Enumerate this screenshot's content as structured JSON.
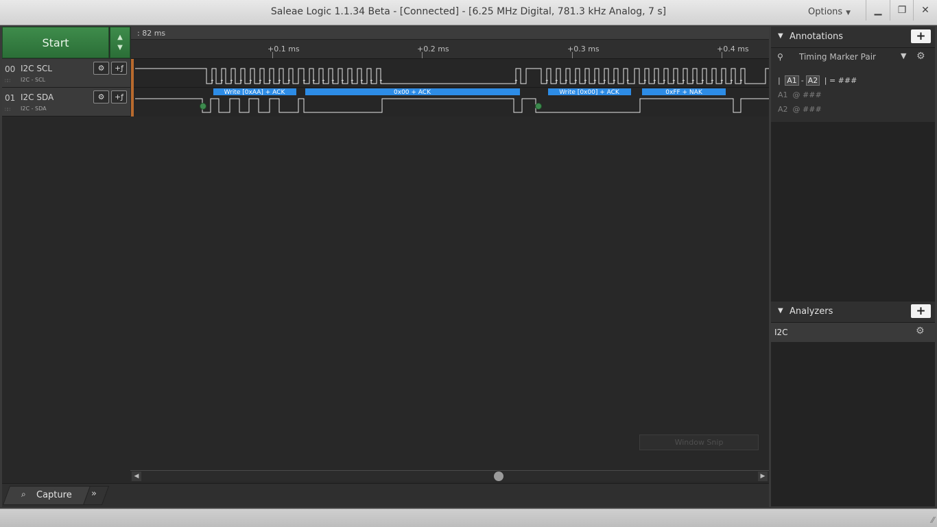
{
  "window": {
    "title": "Saleae Logic 1.1.34 Beta - [Connected] - [6.25 MHz Digital, 781.3 kHz Analog, 7 s]",
    "options_label": "Options",
    "minimize_icon": "minimize-icon",
    "restore_icon": "restore-icon",
    "close_icon": "close-icon"
  },
  "toolbar": {
    "start_label": "Start"
  },
  "ruler": {
    "offset": ": 82 ms",
    "ticks": [
      "+0.1 ms",
      "+0.2 ms",
      "+0.3 ms",
      "+0.4 ms"
    ]
  },
  "channels": [
    {
      "number": "00",
      "name": "I2C SCL",
      "subtitle": "I2C - SCL"
    },
    {
      "number": "01",
      "name": "I2C SDA",
      "subtitle": "I2C - SDA"
    }
  ],
  "decodes": [
    "Write [0xAA] + ACK",
    "0x00 + ACK",
    "Write [0x00] + ACK",
    "0xFF + NAK"
  ],
  "overlay": {
    "window_snip": "Window Snip"
  },
  "tabs": {
    "capture_label": "Capture"
  },
  "annotations": {
    "title": "Annotations",
    "marker_type": "Timing Marker Pair",
    "line1_prefix": "|",
    "line1_a1": "A1",
    "line1_dash": "-",
    "line1_a2": "A2",
    "line1_suffix": "| = ###",
    "a1_label": "A1",
    "a1_value": "@ ###",
    "a2_label": "A2",
    "a2_value": "@ ###"
  },
  "analyzers": {
    "title": "Analyzers",
    "items": [
      "I2C"
    ]
  },
  "colors": {
    "start_green": "#2f7a3c",
    "decode_blue": "#2d8ce6",
    "trace_white": "#e8e8e8"
  }
}
